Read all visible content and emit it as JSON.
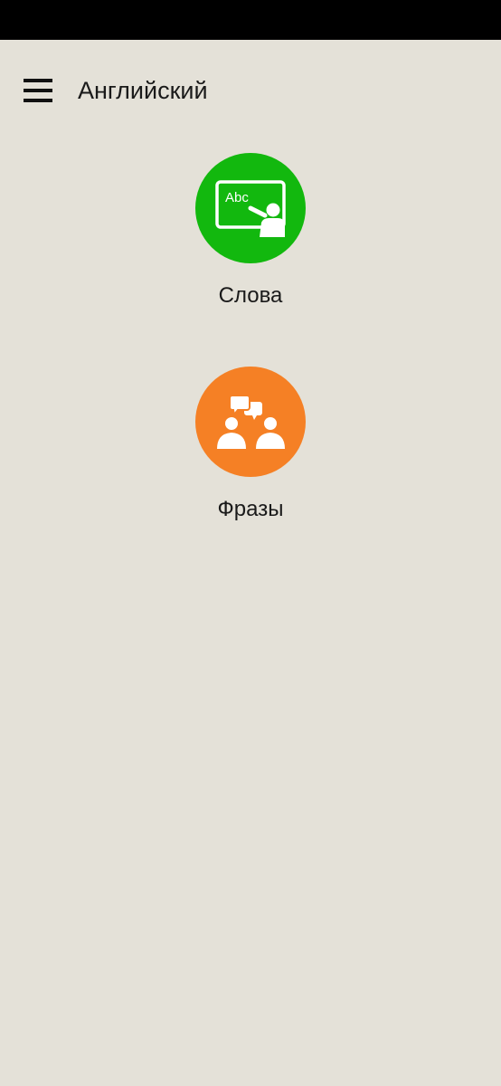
{
  "app_bar": {
    "title": "Английский",
    "menu_icon": "hamburger-menu-icon"
  },
  "sections": [
    {
      "label": "Слова",
      "icon": "teacher-blackboard-icon",
      "board_text": "Abc",
      "color": "#12b80e"
    },
    {
      "label": "Фразы",
      "icon": "conversation-people-icon",
      "color": "#f58025"
    }
  ],
  "colors": {
    "background": "#e4e1d8",
    "status_bar": "#000000",
    "text": "#1a1a1a"
  }
}
